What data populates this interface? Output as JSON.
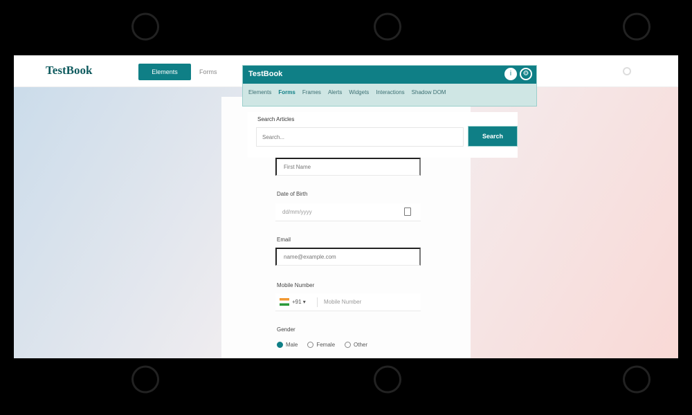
{
  "header": {
    "brand": "TestBook",
    "nav_active": "Elements",
    "nav_plain": "Forms"
  },
  "modal": {
    "title": "TestBook",
    "tabs": [
      "Elements",
      "Forms",
      "Frames",
      "Alerts",
      "Widgets",
      "Interactions",
      "Shadow DOM"
    ]
  },
  "search": {
    "label": "Search Articles",
    "placeholder": "Search...",
    "button": "Search"
  },
  "form": {
    "name_placeholder": "First Name",
    "dob_label": "Date of Birth",
    "dob_placeholder": "dd/mm/yyyy",
    "email_label": "Email",
    "email_placeholder": "name@example.com",
    "mobile_label": "Mobile Number",
    "country_code": "+91 ▾",
    "mobile_placeholder": "Mobile Number",
    "gender_label": "Gender",
    "gender_options": [
      "Male",
      "Female",
      "Other"
    ]
  },
  "colors": {
    "accent": "#0f7f86",
    "brand_text": "#0e5a5e"
  },
  "icons": {
    "modal_icon_1": "info-icon",
    "modal_icon_2": "settings-icon",
    "calendar": "calendar-icon",
    "flag": "flag-icon"
  }
}
